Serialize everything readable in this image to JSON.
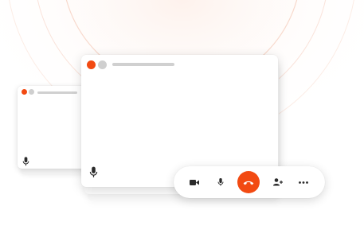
{
  "colors": {
    "accent": "#f24a12",
    "placeholder_bar": "#d0d0d0",
    "icon": "#2b2b2b",
    "window_background": "#ffffff"
  },
  "icons": {
    "small_window_mic": "mic-icon",
    "main_window_mic": "mic-icon",
    "toolbar": [
      "video-camera-icon",
      "mic-icon",
      "end-call-icon",
      "add-user-icon",
      "more-options-icon"
    ]
  }
}
